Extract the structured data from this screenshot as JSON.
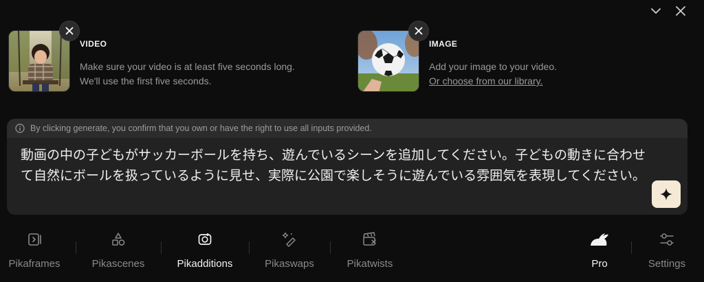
{
  "video_card": {
    "title": "VIDEO",
    "desc_line1": "Make sure your video is at least five seconds long.",
    "desc_line2": "We'll use the first five seconds."
  },
  "image_card": {
    "title": "IMAGE",
    "desc": "Add your image to your video.",
    "link": "Or choose from our library."
  },
  "prompt": {
    "disclaimer": "By clicking generate, you confirm that you own or have the right to use all inputs provided.",
    "text": "動画の中の子どもがサッカーボールを持ち、遊んでいるシーンを追加してください。子どもの動きに合わせて自然にボールを扱っているように見せ、実際に公園で楽しそうに遊んでいる雰囲気を表現してください。"
  },
  "nav": {
    "items": [
      {
        "label": "Pikaframes",
        "icon": "frames-icon"
      },
      {
        "label": "Pikascenes",
        "icon": "shapes-icon"
      },
      {
        "label": "Pikadditions",
        "icon": "add-object-icon",
        "active": true
      },
      {
        "label": "Pikaswaps",
        "icon": "magic-brush-icon"
      },
      {
        "label": "Pikatwists",
        "icon": "clapperboard-icon"
      }
    ],
    "pro_label": "Pro",
    "settings_label": "Settings"
  },
  "colors": {
    "background": "#0d0d0d",
    "prompt_bg": "#222222",
    "generate_button": "#f6ead6"
  }
}
